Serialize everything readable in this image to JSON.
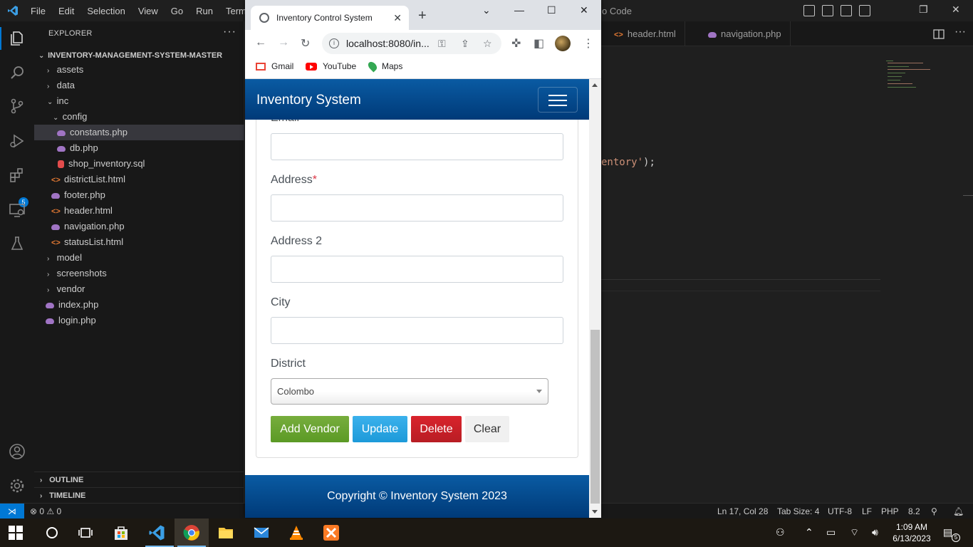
{
  "vscode": {
    "menu": [
      "File",
      "Edit",
      "Selection",
      "View",
      "Go",
      "Run",
      "Termina"
    ],
    "title_partial": "o Code",
    "explorer_title": "EXPLORER",
    "root": "INVENTORY-MANAGEMENT-SYSTEM-MASTER",
    "tree": [
      {
        "label": "assets",
        "type": "folder",
        "open": false,
        "depth": 1
      },
      {
        "label": "data",
        "type": "folder",
        "open": false,
        "depth": 1
      },
      {
        "label": "inc",
        "type": "folder",
        "open": true,
        "depth": 1
      },
      {
        "label": "config",
        "type": "folder",
        "open": true,
        "depth": 2
      },
      {
        "label": "constants.php",
        "type": "php",
        "depth": 3,
        "selected": true
      },
      {
        "label": "db.php",
        "type": "php",
        "depth": 3
      },
      {
        "label": "shop_inventory.sql",
        "type": "sql",
        "depth": 3
      },
      {
        "label": "districtList.html",
        "type": "html",
        "depth": 2
      },
      {
        "label": "footer.php",
        "type": "php",
        "depth": 2
      },
      {
        "label": "header.html",
        "type": "html",
        "depth": 2
      },
      {
        "label": "navigation.php",
        "type": "php",
        "depth": 2
      },
      {
        "label": "statusList.html",
        "type": "html",
        "depth": 2
      },
      {
        "label": "model",
        "type": "folder",
        "open": false,
        "depth": 1
      },
      {
        "label": "screenshots",
        "type": "folder",
        "open": false,
        "depth": 1
      },
      {
        "label": "vendor",
        "type": "folder",
        "open": false,
        "depth": 1
      },
      {
        "label": "index.php",
        "type": "php",
        "depth": 1
      },
      {
        "label": "login.php",
        "type": "php",
        "depth": 1
      }
    ],
    "outline": "OUTLINE",
    "timeline": "TIMELINE",
    "tabs": [
      "header.html",
      "navigation.php"
    ],
    "code_fragment": "entory'",
    "code_punct": ");",
    "extensions_badge": "5",
    "status": {
      "errors": "0",
      "warnings": "0",
      "position": "Ln 17, Col 28",
      "tab_size": "Tab Size: 4",
      "encoding": "UTF-8",
      "eol": "LF",
      "language": "PHP",
      "version": "8.2"
    }
  },
  "chrome": {
    "tab_title": "Inventory Control System",
    "url": "localhost:8080/in...",
    "bookmarks": [
      "Gmail",
      "YouTube",
      "Maps"
    ]
  },
  "page": {
    "brand": "Inventory System",
    "email_label": "Email",
    "address_label": "Address",
    "address_required": "*",
    "address2_label": "Address 2",
    "city_label": "City",
    "district_label": "District",
    "district_value": "Colombo",
    "buttons": {
      "add": "Add Vendor",
      "update": "Update",
      "delete": "Delete",
      "clear": "Clear"
    },
    "footer": "Copyright © Inventory System 2023",
    "colors": {
      "navbar": "#0a5ba3",
      "add": "#5b9a25",
      "update": "#1d9ad9",
      "delete": "#b81d24"
    }
  },
  "taskbar": {
    "time": "1:09 AM",
    "date": "6/13/2023",
    "notifications": "5"
  }
}
